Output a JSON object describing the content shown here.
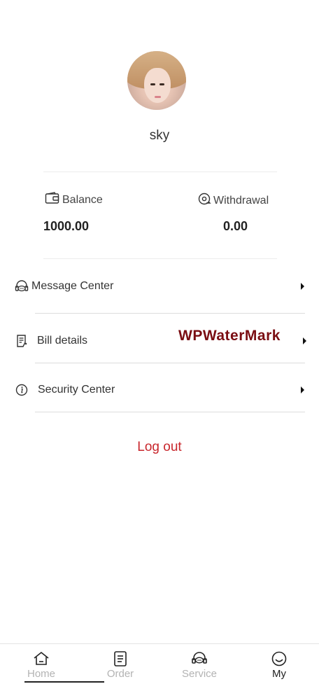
{
  "profile": {
    "username": "sky"
  },
  "stats": {
    "balance": {
      "label": "Balance",
      "value": "1000.00",
      "icon": "wallet-icon"
    },
    "withdrawal": {
      "label": "Withdrawal",
      "value": "0.00",
      "icon": "withdrawal-icon"
    }
  },
  "menu": {
    "items": [
      {
        "label": "Message Center",
        "icon": "headset-icon"
      },
      {
        "label": "Bill details",
        "icon": "bill-icon"
      },
      {
        "label": "Security Center",
        "icon": "info-icon"
      }
    ]
  },
  "watermark": "WPWaterMark",
  "logout_label": "Log out",
  "tabbar": {
    "tabs": [
      {
        "label": "Home",
        "icon": "home-icon"
      },
      {
        "label": "Order",
        "icon": "order-icon"
      },
      {
        "label": "Service",
        "icon": "service-icon"
      },
      {
        "label": "My",
        "icon": "smile-icon",
        "active": true
      }
    ]
  },
  "colors": {
    "logout": "#c8262c",
    "watermark": "#7a0d12",
    "tab_inactive": "#b3b3b3",
    "tab_active": "#222222"
  }
}
